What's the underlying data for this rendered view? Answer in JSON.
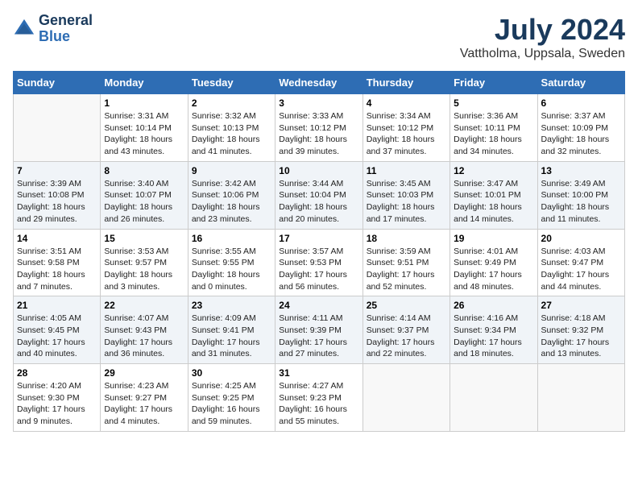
{
  "logo": {
    "line1": "General",
    "line2": "Blue"
  },
  "title": "July 2024",
  "subtitle": "Vattholma, Uppsala, Sweden",
  "days_of_week": [
    "Sunday",
    "Monday",
    "Tuesday",
    "Wednesday",
    "Thursday",
    "Friday",
    "Saturday"
  ],
  "weeks": [
    [
      {
        "day": "",
        "info": ""
      },
      {
        "day": "1",
        "info": "Sunrise: 3:31 AM\nSunset: 10:14 PM\nDaylight: 18 hours\nand 43 minutes."
      },
      {
        "day": "2",
        "info": "Sunrise: 3:32 AM\nSunset: 10:13 PM\nDaylight: 18 hours\nand 41 minutes."
      },
      {
        "day": "3",
        "info": "Sunrise: 3:33 AM\nSunset: 10:12 PM\nDaylight: 18 hours\nand 39 minutes."
      },
      {
        "day": "4",
        "info": "Sunrise: 3:34 AM\nSunset: 10:12 PM\nDaylight: 18 hours\nand 37 minutes."
      },
      {
        "day": "5",
        "info": "Sunrise: 3:36 AM\nSunset: 10:11 PM\nDaylight: 18 hours\nand 34 minutes."
      },
      {
        "day": "6",
        "info": "Sunrise: 3:37 AM\nSunset: 10:09 PM\nDaylight: 18 hours\nand 32 minutes."
      }
    ],
    [
      {
        "day": "7",
        "info": "Sunrise: 3:39 AM\nSunset: 10:08 PM\nDaylight: 18 hours\nand 29 minutes."
      },
      {
        "day": "8",
        "info": "Sunrise: 3:40 AM\nSunset: 10:07 PM\nDaylight: 18 hours\nand 26 minutes."
      },
      {
        "day": "9",
        "info": "Sunrise: 3:42 AM\nSunset: 10:06 PM\nDaylight: 18 hours\nand 23 minutes."
      },
      {
        "day": "10",
        "info": "Sunrise: 3:44 AM\nSunset: 10:04 PM\nDaylight: 18 hours\nand 20 minutes."
      },
      {
        "day": "11",
        "info": "Sunrise: 3:45 AM\nSunset: 10:03 PM\nDaylight: 18 hours\nand 17 minutes."
      },
      {
        "day": "12",
        "info": "Sunrise: 3:47 AM\nSunset: 10:01 PM\nDaylight: 18 hours\nand 14 minutes."
      },
      {
        "day": "13",
        "info": "Sunrise: 3:49 AM\nSunset: 10:00 PM\nDaylight: 18 hours\nand 11 minutes."
      }
    ],
    [
      {
        "day": "14",
        "info": "Sunrise: 3:51 AM\nSunset: 9:58 PM\nDaylight: 18 hours\nand 7 minutes."
      },
      {
        "day": "15",
        "info": "Sunrise: 3:53 AM\nSunset: 9:57 PM\nDaylight: 18 hours\nand 3 minutes."
      },
      {
        "day": "16",
        "info": "Sunrise: 3:55 AM\nSunset: 9:55 PM\nDaylight: 18 hours\nand 0 minutes."
      },
      {
        "day": "17",
        "info": "Sunrise: 3:57 AM\nSunset: 9:53 PM\nDaylight: 17 hours\nand 56 minutes."
      },
      {
        "day": "18",
        "info": "Sunrise: 3:59 AM\nSunset: 9:51 PM\nDaylight: 17 hours\nand 52 minutes."
      },
      {
        "day": "19",
        "info": "Sunrise: 4:01 AM\nSunset: 9:49 PM\nDaylight: 17 hours\nand 48 minutes."
      },
      {
        "day": "20",
        "info": "Sunrise: 4:03 AM\nSunset: 9:47 PM\nDaylight: 17 hours\nand 44 minutes."
      }
    ],
    [
      {
        "day": "21",
        "info": "Sunrise: 4:05 AM\nSunset: 9:45 PM\nDaylight: 17 hours\nand 40 minutes."
      },
      {
        "day": "22",
        "info": "Sunrise: 4:07 AM\nSunset: 9:43 PM\nDaylight: 17 hours\nand 36 minutes."
      },
      {
        "day": "23",
        "info": "Sunrise: 4:09 AM\nSunset: 9:41 PM\nDaylight: 17 hours\nand 31 minutes."
      },
      {
        "day": "24",
        "info": "Sunrise: 4:11 AM\nSunset: 9:39 PM\nDaylight: 17 hours\nand 27 minutes."
      },
      {
        "day": "25",
        "info": "Sunrise: 4:14 AM\nSunset: 9:37 PM\nDaylight: 17 hours\nand 22 minutes."
      },
      {
        "day": "26",
        "info": "Sunrise: 4:16 AM\nSunset: 9:34 PM\nDaylight: 17 hours\nand 18 minutes."
      },
      {
        "day": "27",
        "info": "Sunrise: 4:18 AM\nSunset: 9:32 PM\nDaylight: 17 hours\nand 13 minutes."
      }
    ],
    [
      {
        "day": "28",
        "info": "Sunrise: 4:20 AM\nSunset: 9:30 PM\nDaylight: 17 hours\nand 9 minutes."
      },
      {
        "day": "29",
        "info": "Sunrise: 4:23 AM\nSunset: 9:27 PM\nDaylight: 17 hours\nand 4 minutes."
      },
      {
        "day": "30",
        "info": "Sunrise: 4:25 AM\nSunset: 9:25 PM\nDaylight: 16 hours\nand 59 minutes."
      },
      {
        "day": "31",
        "info": "Sunrise: 4:27 AM\nSunset: 9:23 PM\nDaylight: 16 hours\nand 55 minutes."
      },
      {
        "day": "",
        "info": ""
      },
      {
        "day": "",
        "info": ""
      },
      {
        "day": "",
        "info": ""
      }
    ]
  ],
  "colors": {
    "header_bg": "#2e6db4",
    "header_text": "#ffffff",
    "logo_dark": "#1a3a5c",
    "odd_row": "#ffffff",
    "even_row": "#f0f4f8"
  }
}
